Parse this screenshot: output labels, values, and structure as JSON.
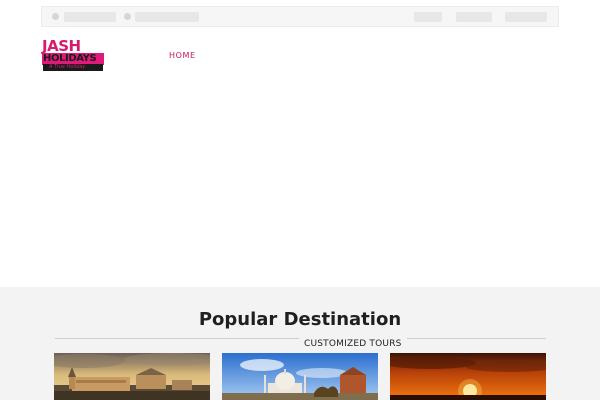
{
  "brand": {
    "line1": "JASH",
    "line2": "HOLIDAYS",
    "tagline": "A True Holiday"
  },
  "nav": {
    "home": "HOME"
  },
  "popular": {
    "title": "Popular Destination",
    "subtitle": "CUSTOMIZED TOURS"
  },
  "colors": {
    "brand_pink": "#d81b6e",
    "nav_active": "#c2185b",
    "section_bg": "#f3f3f3"
  }
}
